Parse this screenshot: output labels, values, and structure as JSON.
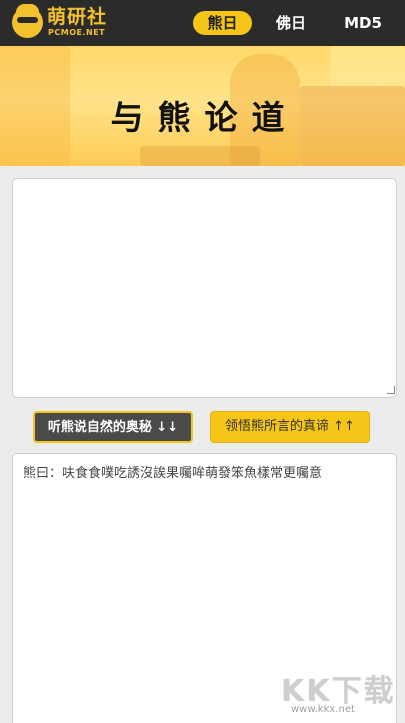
{
  "header": {
    "logo_title": "萌研社",
    "logo_subtitle": "PCMOE.NET",
    "nav": [
      {
        "label": "熊日",
        "active": true
      },
      {
        "label": "佛日",
        "active": false
      },
      {
        "label": "MD5",
        "active": false
      }
    ]
  },
  "banner": {
    "title": "与熊论道"
  },
  "input": {
    "value": ""
  },
  "buttons": {
    "decode_label": "听熊说自然的奥秘 ↓↓",
    "encode_label": "领悟熊所言的真谛 ↑↑"
  },
  "output": {
    "value": "熊曰：呋食食噗吃誘沒誒果囑哞萌發笨魚樣常更囑意"
  },
  "watermark": {
    "main": "KK下载",
    "url": "www.kkx.net"
  },
  "colors": {
    "accent": "#f5c518",
    "topbar": "#2b2b2b"
  }
}
